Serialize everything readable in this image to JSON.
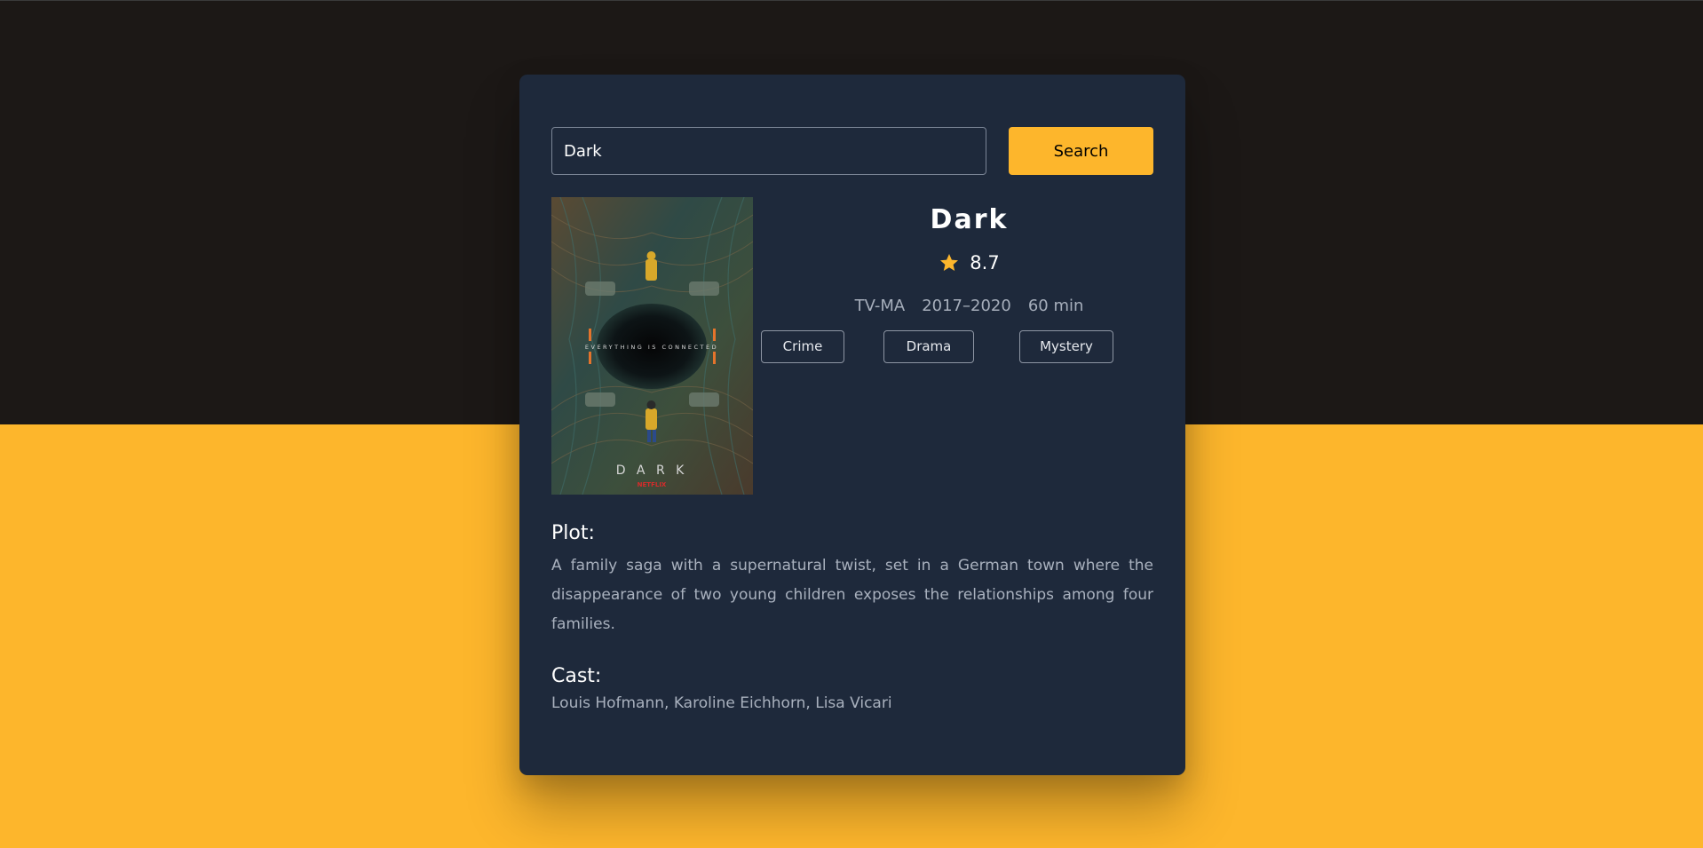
{
  "search": {
    "value": "Dark",
    "button_label": "Search"
  },
  "movie": {
    "title": "Dark",
    "rating": "8.7",
    "rated": "TV-MA",
    "years": "2017–2020",
    "runtime": "60 min",
    "genres": [
      "Crime",
      "Drama",
      "Mystery"
    ],
    "poster": {
      "tagline": "EVERYTHING IS CONNECTED",
      "wordmark": "D A R K",
      "network": "NETFLIX"
    }
  },
  "plot": {
    "heading": "Plot:",
    "text": "A family saga with a supernatural twist, set in a German town where the disappearance of two young children exposes the relationships among four families."
  },
  "cast": {
    "heading": "Cast:",
    "text": "Louis Hofmann, Karoline Eichhorn, Lisa Vicari"
  },
  "colors": {
    "accent": "#fdb62c",
    "card": "#1e293b",
    "top_background": "#1c1816"
  },
  "icons": {
    "rating": "star-icon"
  }
}
